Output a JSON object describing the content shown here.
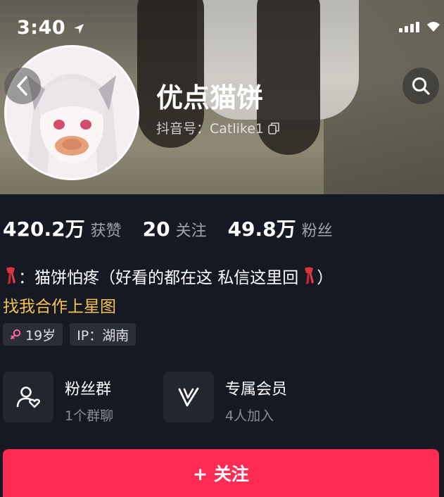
{
  "status_bar": {
    "time": "3:40"
  },
  "profile": {
    "name": "优点猫饼",
    "douyin_id": "抖音号：Catlike1"
  },
  "stats": [
    {
      "value": "420.2万",
      "label": "获赞"
    },
    {
      "value": "20",
      "label": "关注"
    },
    {
      "value": "49.8万",
      "label": "粉丝"
    }
  ],
  "bio": {
    "text": "：猫饼怕疼（好看的都在这 私信这里回",
    "close_paren": "）",
    "collab_link": "找我合作上星图"
  },
  "tags": [
    {
      "label": "19岁",
      "icon": "female-icon"
    },
    {
      "label": "IP：湖南"
    }
  ],
  "cards": [
    {
      "title": "粉丝群",
      "subtitle": "1个群聊",
      "icon": "fan-group-icon"
    },
    {
      "title": "专属会员",
      "subtitle": "4人加入",
      "icon": "membership-icon"
    }
  ],
  "follow_button": {
    "label": "+ 关注"
  },
  "colors": {
    "background": "#161823",
    "accent": "#fe2c55",
    "collab": "#f3c34c"
  }
}
